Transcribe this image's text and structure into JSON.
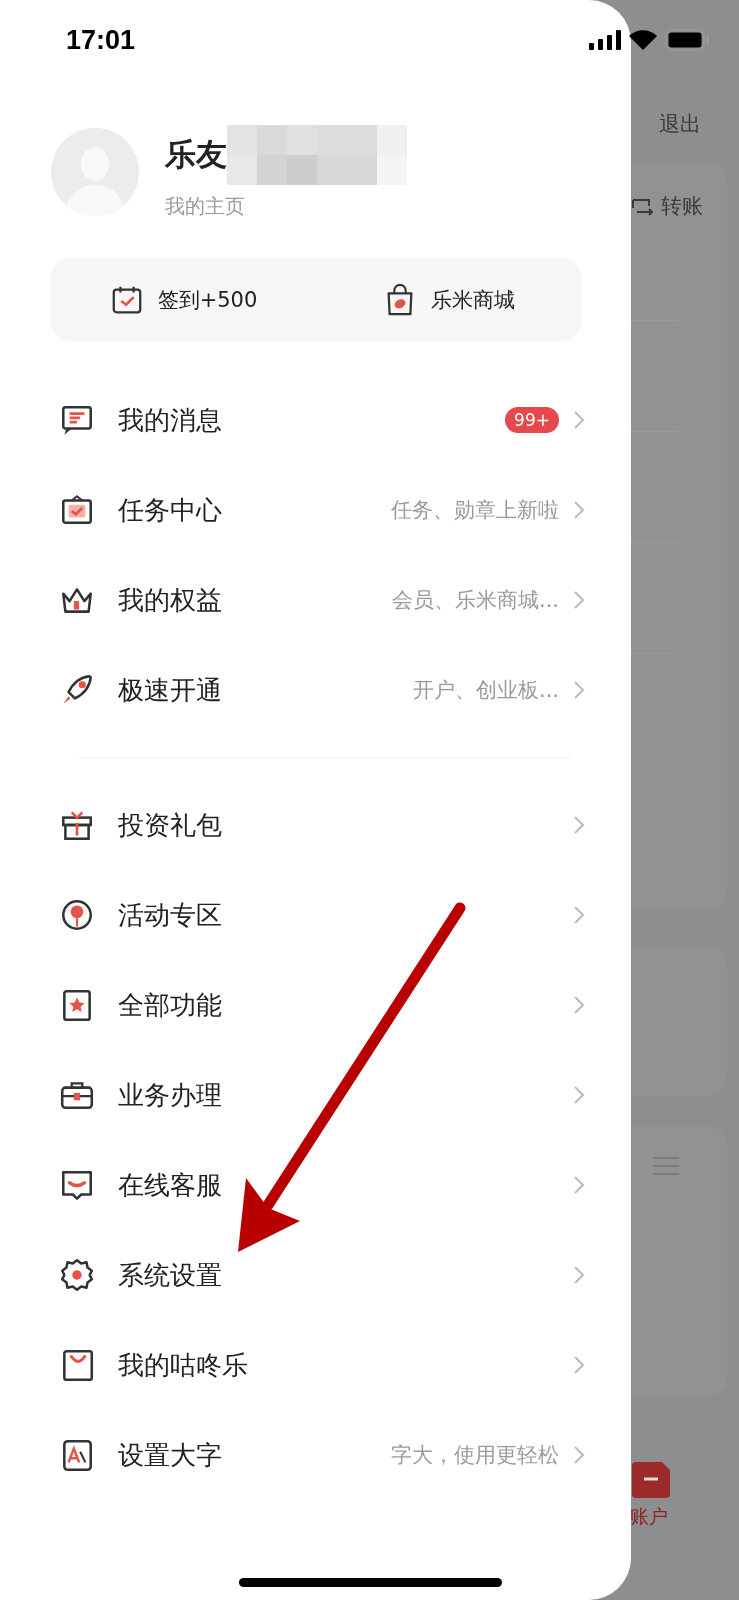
{
  "status_bar": {
    "time": "17:01"
  },
  "profile": {
    "name": "乐友",
    "link": "我的主页"
  },
  "quick_actions": [
    {
      "label": "签到+500"
    },
    {
      "label": "乐米商城"
    }
  ],
  "menu_groups": [
    [
      {
        "label": "我的消息",
        "badge": "99+"
      },
      {
        "label": "任务中心",
        "hint": "任务、勋章上新啦"
      },
      {
        "label": "我的权益",
        "hint": "会员、乐米商城..."
      },
      {
        "label": "极速开通",
        "hint": "开户、创业板..."
      }
    ],
    [
      {
        "label": "投资礼包"
      },
      {
        "label": "活动专区"
      },
      {
        "label": "全部功能"
      },
      {
        "label": "业务办理"
      },
      {
        "label": "在线客服"
      },
      {
        "label": "系统设置"
      },
      {
        "label": "我的咕咚乐"
      },
      {
        "label": "设置大字",
        "hint": "字大，使用更轻松"
      }
    ]
  ],
  "background": {
    "logout": "退出",
    "transfer": "转账",
    "tab": "账户"
  }
}
